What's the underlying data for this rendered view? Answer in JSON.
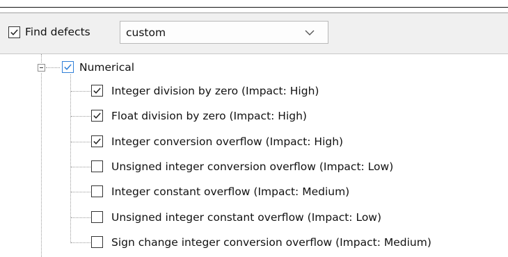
{
  "header": {
    "find_defects_label": "Find defects",
    "find_defects_checked": true,
    "mode_select": {
      "value": "custom"
    }
  },
  "tree": {
    "group": {
      "label": "Numerical",
      "checked": true,
      "expanded": true
    },
    "items": [
      {
        "label": "Integer division by zero (Impact: High)",
        "checked": true
      },
      {
        "label": "Float division by zero (Impact: High)",
        "checked": true
      },
      {
        "label": "Integer conversion overflow (Impact: High)",
        "checked": true
      },
      {
        "label": "Unsigned integer conversion overflow (Impact: Low)",
        "checked": false
      },
      {
        "label": "Integer constant overflow (Impact: Medium)",
        "checked": false
      },
      {
        "label": "Unsigned integer constant overflow (Impact: Low)",
        "checked": false
      },
      {
        "label": "Sign change integer conversion overflow (Impact: Medium)",
        "checked": false
      }
    ]
  },
  "colors": {
    "accent": "#2f7fd8",
    "header_bg": "#f0f0f0",
    "tree_lines": "#9a9a9a"
  },
  "icons": [
    "checkmark-icon",
    "chevron-down-icon",
    "tree-collapse-icon"
  ]
}
